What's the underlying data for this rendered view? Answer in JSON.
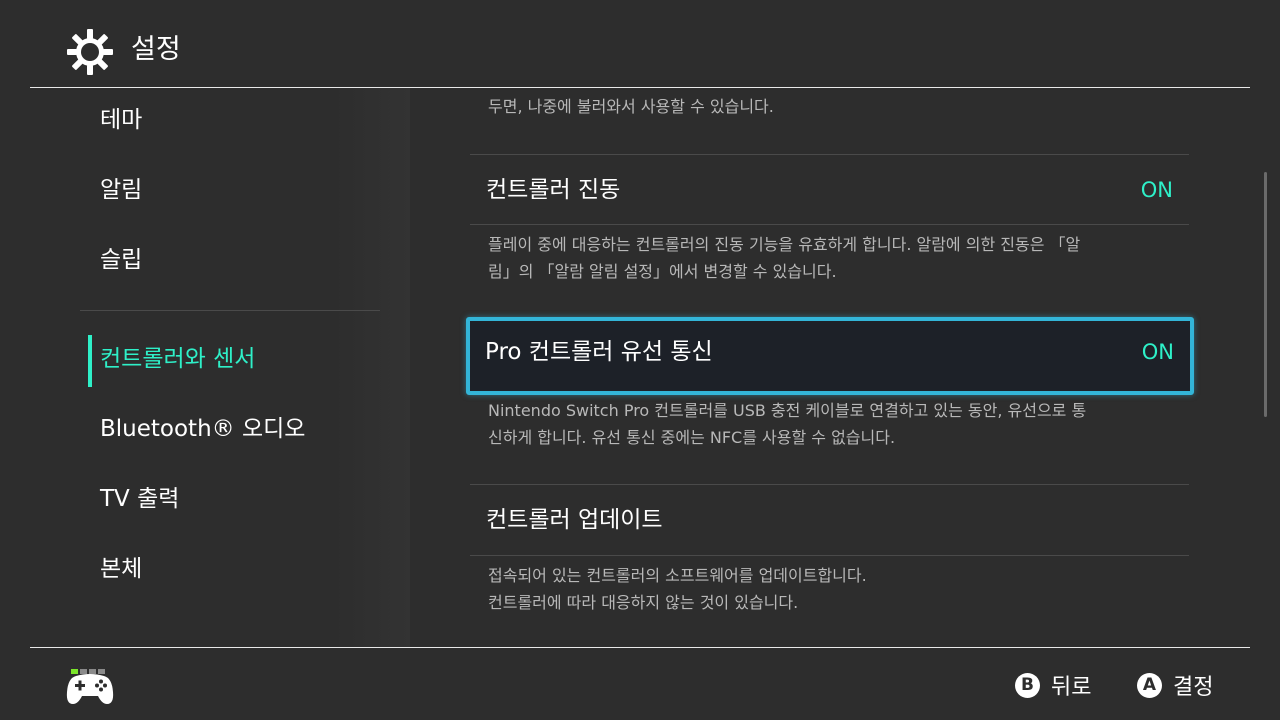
{
  "header": {
    "title": "설정",
    "icon": "gear-icon"
  },
  "sidebar": {
    "items": [
      {
        "label": "테마"
      },
      {
        "label": "알림"
      },
      {
        "label": "슬립"
      },
      {
        "label": "컨트롤러와 센서",
        "active": true
      },
      {
        "label": "Bluetooth® 오디오"
      },
      {
        "label": "TV 출력"
      },
      {
        "label": "본체"
      }
    ]
  },
  "content": {
    "top_partial_desc": "두면, 나중에 불러와서 사용할 수 있습니다.",
    "rows": [
      {
        "title": "컨트롤러 진동",
        "value": "ON",
        "desc_line1": "플레이 중에 대응하는 컨트롤러의 진동 기능을 유효하게 합니다. 알람에 의한 진동은 「알",
        "desc_line2": "림」의 「알람 알림 설정」에서 변경할 수 있습니다."
      },
      {
        "title": "Pro 컨트롤러 유선 통신",
        "value": "ON",
        "selected": true,
        "desc_line1": "Nintendo Switch Pro 컨트롤러를 USB 충전 케이블로 연결하고 있는 동안, 유선으로 통",
        "desc_line2": "신하게 합니다. 유선 통신 중에는 NFC를 사용할 수 없습니다."
      },
      {
        "title": "컨트롤러 업데이트",
        "value": "",
        "desc_line1": "접속되어 있는 컨트롤러의 소프트웨어를 업데이트합니다.",
        "desc_line2": "컨트롤러에 따라 대응하지 않는 것이 있습니다."
      }
    ]
  },
  "footer": {
    "back": {
      "button": "B",
      "label": "뒤로"
    },
    "confirm": {
      "button": "A",
      "label": "결정"
    }
  },
  "colors": {
    "accent": "#2ef0c8",
    "focus": "#33b5d8",
    "background": "#2d2d2d",
    "page_indicator": "#7be52a"
  }
}
